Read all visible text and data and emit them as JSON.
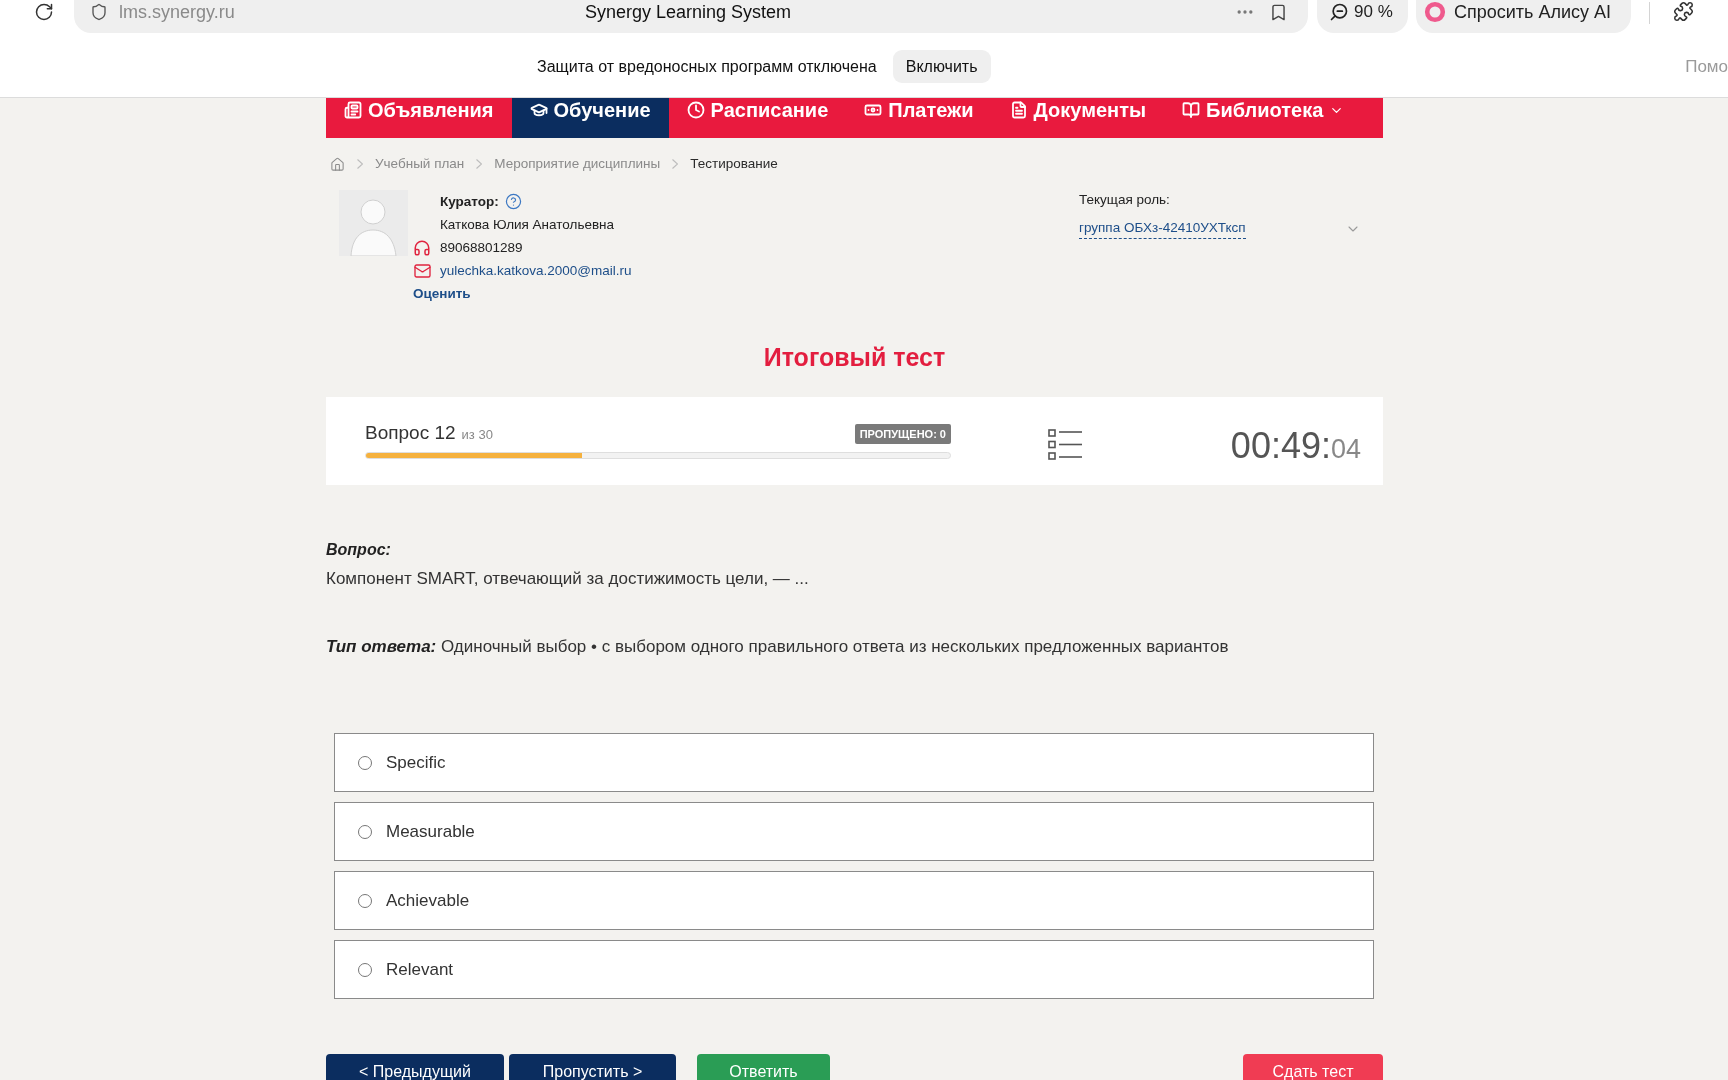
{
  "browser": {
    "address": "lms.synergy.ru",
    "page_title": "Synergy Learning System",
    "zoom": "90 %",
    "assistant_button": "Спросить Алису AI"
  },
  "infobar": {
    "message": "Защита от вредоносных программ отключена",
    "button": "Включить",
    "side_text": "Помо"
  },
  "nav": {
    "items": [
      {
        "label": "Объявления",
        "selected": false,
        "dropdown": false
      },
      {
        "label": "Обучение",
        "selected": true,
        "dropdown": false
      },
      {
        "label": "Расписание",
        "selected": false,
        "dropdown": false
      },
      {
        "label": "Платежи",
        "selected": false,
        "dropdown": false
      },
      {
        "label": "Документы",
        "selected": false,
        "dropdown": false
      },
      {
        "label": "Библиотека",
        "selected": false,
        "dropdown": true
      }
    ]
  },
  "breadcrumb": {
    "items": [
      {
        "label": "Учебный план",
        "current": false
      },
      {
        "label": "Мероприятие дисциплины",
        "current": false
      },
      {
        "label": "Тестирование",
        "current": true
      }
    ]
  },
  "curator": {
    "label": "Куратор:",
    "name": "Каткова Юлия Анатольевна",
    "phone": "89068801289",
    "email": "yulechka.katkova.2000@mail.ru",
    "rate_link": "Оценить"
  },
  "role": {
    "label": "Текущая роль:",
    "value": "группа ОБХз-42410УХТксп"
  },
  "test": {
    "title": "Итоговый тест",
    "counter": "Вопрос 12",
    "counter_total": "из 30",
    "skipped_badge": "ПРОПУЩЕНО: 0",
    "progress": {
      "level": 0.37
    },
    "timer": {
      "main": "00:49:",
      "seconds": "04"
    }
  },
  "question": {
    "label": "Вопрос:",
    "text": "Компонент SMART, отвечающий за достижимость цели, — ...",
    "answer_type_label": "Тип ответа:",
    "answer_type": "Одиночный выбор • с выбором одного правильного ответа из нескольких предложенных вариантов"
  },
  "options": [
    {
      "label": "Specific",
      "selected": false
    },
    {
      "label": "Measurable",
      "selected": false
    },
    {
      "label": "Achievable",
      "selected": false
    },
    {
      "label": "Relevant",
      "selected": false
    }
  ],
  "buttons": [
    {
      "label": "< Предыдущий",
      "kind": "previous"
    },
    {
      "label": "Пропустить >",
      "kind": "skip"
    },
    {
      "label": "Ответить",
      "kind": "answer"
    },
    {
      "label": "Сдать тест",
      "kind": "submit"
    }
  ]
}
